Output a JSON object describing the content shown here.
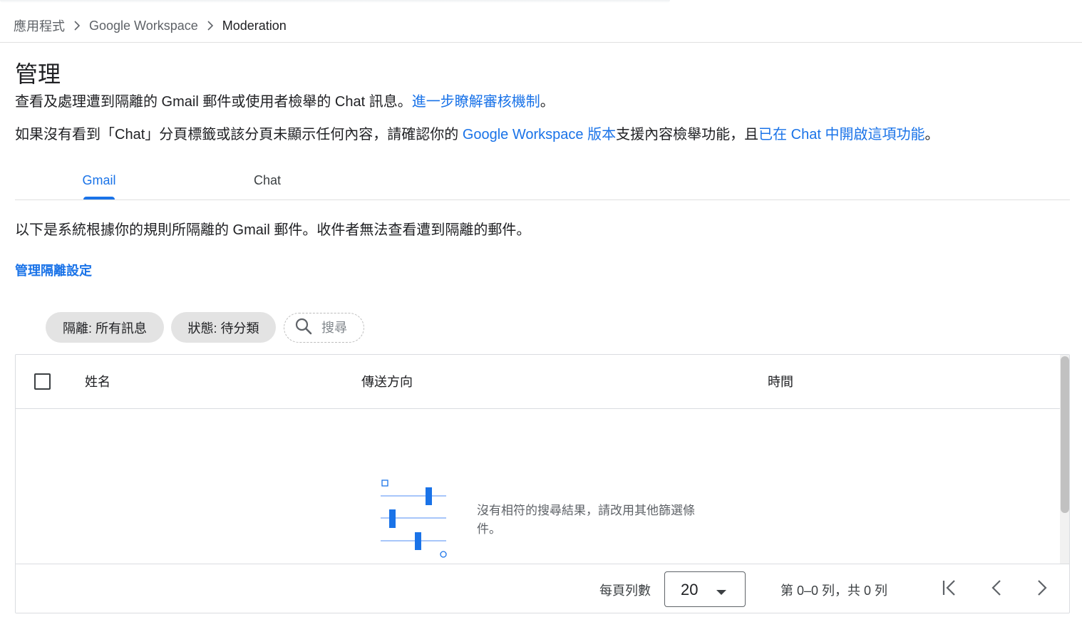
{
  "breadcrumb": {
    "items": [
      "應用程式",
      "Google Workspace",
      "Moderation"
    ]
  },
  "page": {
    "title": "管理",
    "desc1_text": "查看及處理遭到隔離的 Gmail 郵件或使用者檢舉的 Chat 訊息。",
    "desc1_link": "進一步瞭解審核機制",
    "desc1_end": "。",
    "desc2_text1": "如果沒有看到「Chat」分頁標籤或該分頁未顯示任何內容，請確認你的 ",
    "desc2_link1": "Google Workspace 版本",
    "desc2_text2": "支援內容檢舉功能，且",
    "desc2_link2": "已在 Chat 中開啟這項功能",
    "desc2_end": "。"
  },
  "tabs": {
    "gmail": "Gmail",
    "chat": "Chat",
    "active": "gmail"
  },
  "gmail_section": {
    "description": "以下是系統根據你的規則所隔離的 Gmail 郵件。收件者無法查看遭到隔離的郵件。",
    "manage_link": "管理隔離設定"
  },
  "filters": {
    "quarantine_chip": "隔離: 所有訊息",
    "status_chip": "狀態: 待分類",
    "search_placeholder": "搜尋"
  },
  "table": {
    "columns": [
      "姓名",
      "傳送方向",
      "時間"
    ],
    "rows": [],
    "empty_message": "沒有相符的搜尋結果，請改用其他篩選條件。"
  },
  "pagination": {
    "rows_per_page_label": "每頁列數",
    "rows_per_page_value": "20",
    "range_text": "第 0–0 列，共 0 列"
  },
  "colors": {
    "accent": "#1a73e8",
    "chip_bg": "#e3e3e3",
    "text_primary": "#202124",
    "text_secondary": "#5f6368"
  }
}
